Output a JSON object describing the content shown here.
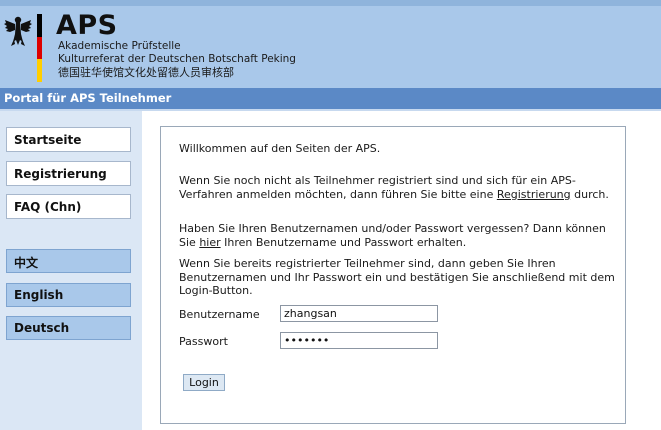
{
  "header": {
    "title": "APS",
    "line1": "Akademische Prüfstelle",
    "line2": "Kulturreferat der Deutschen Botschaft Peking",
    "line3": "德国驻华使馆文化处留德人员审核部",
    "flag_colors": [
      "#000000",
      "#dd0000",
      "#ffce00"
    ]
  },
  "portal": {
    "label": "Portal für APS Teilnehmer"
  },
  "sidebar": {
    "nav": [
      {
        "label": "Startseite"
      },
      {
        "label": "Registrierung"
      },
      {
        "label": "FAQ (Chn)"
      }
    ],
    "languages": [
      {
        "label": "中文"
      },
      {
        "label": "English"
      },
      {
        "label": "Deutsch"
      }
    ]
  },
  "main": {
    "welcome": "Willkommen auf den Seiten der APS.",
    "para1_before": "Wenn Sie noch nicht als Teilnehmer registriert sind und sich für ein APS-Verfahren anmelden möchten, dann führen Sie bitte eine ",
    "para1_link": "Registrierung",
    "para1_after": " durch.",
    "para2_before": "Haben Sie Ihren Benutzernamen und/oder Passwort vergessen? Dann können Sie ",
    "para2_link": "hier",
    "para2_after": " Ihren Benutzername und Passwort erhalten.",
    "para3": "Wenn Sie bereits registrierter Teilnehmer sind, dann geben Sie Ihren Benutzernamen und Ihr Passwort ein und bestätigen Sie anschließend mit dem Login-Button."
  },
  "form": {
    "username_label": "Benutzername",
    "username_value": "zhangsan",
    "password_label": "Passwort",
    "password_value": "zhangsa",
    "login_label": "Login"
  },
  "colors": {
    "header_bg": "#a9c8ea",
    "portal_bar": "#5b89c6",
    "sidebar_bg": "#dbe7f5",
    "lang_button": "#a9c8ea"
  }
}
